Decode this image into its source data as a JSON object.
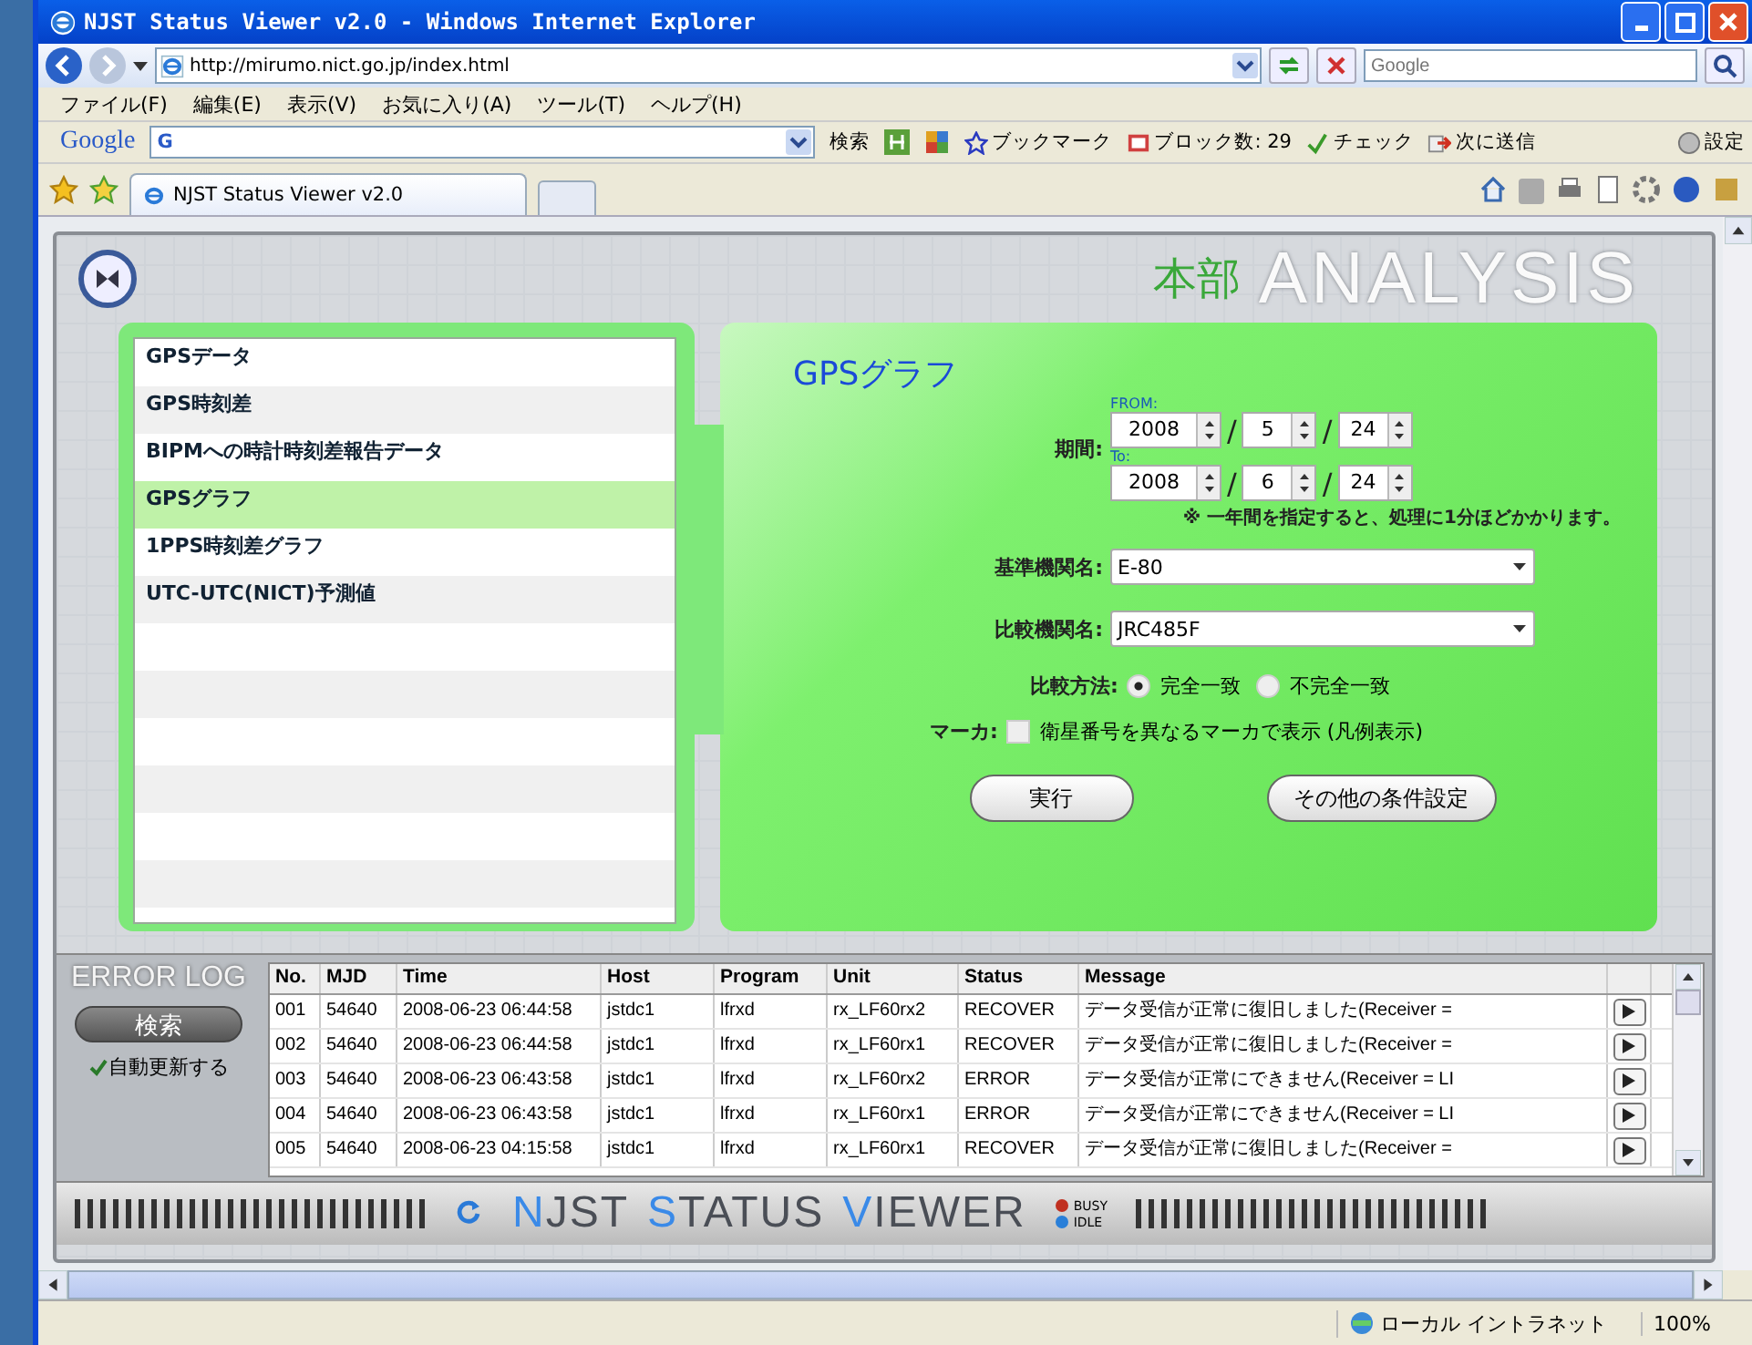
{
  "window": {
    "title": "NJST Status Viewer v2.0 - Windows Internet Explorer"
  },
  "address": {
    "url": "http://mirumo.nict.go.jp/index.html",
    "search_placeholder": "Google"
  },
  "menu": [
    "ファイル(F)",
    "編集(E)",
    "表示(V)",
    "お気に入り(A)",
    "ツール(T)",
    "ヘルプ(H)"
  ],
  "google_toolbar": {
    "logo": "Google",
    "field_logo": "G",
    "search": "検索",
    "bookmarks": "ブックマーク",
    "blocked": "ブロック数: 29",
    "check": "チェック",
    "send": "次に送信",
    "settings": "設定"
  },
  "tab": {
    "label": "NJST Status Viewer v2.0"
  },
  "app": {
    "header_office": "本部",
    "header_mode": "ANALYSIS",
    "menu_items": [
      {
        "label": "GPSデータ",
        "selected": false
      },
      {
        "label": "GPS時刻差",
        "selected": false
      },
      {
        "label": "BIPMへの時計時刻差報告データ",
        "selected": false
      },
      {
        "label": "GPSグラフ",
        "selected": true
      },
      {
        "label": "1PPS時刻差グラフ",
        "selected": false
      },
      {
        "label": "UTC-UTC(NICT)予測値",
        "selected": false
      }
    ],
    "form": {
      "title": "GPSグラフ",
      "period_label": "期間:",
      "from_label": "FROM:",
      "to_label": "To:",
      "from": [
        "2008",
        "5",
        "24"
      ],
      "to": [
        "2008",
        "6",
        "24"
      ],
      "separator": "/",
      "note": "※ 一年間を指定すると、処理に1分ほどかかります。",
      "base_label": "基準機関名:",
      "base_value": "E-80",
      "compare_label": "比較機関名:",
      "compare_value": "JRC485F",
      "method_label": "比較方法:",
      "methods": [
        {
          "label": "完全一致",
          "selected": true
        },
        {
          "label": "不完全一致",
          "selected": false
        }
      ],
      "marker_label": "マーカ:",
      "marker": {
        "label": "衛星番号を異なるマーカで表示 (凡例表示)",
        "checked": false
      },
      "buttons": [
        "実行",
        "その他の条件設定"
      ]
    },
    "error_log": {
      "title": "ERROR LOG",
      "search_button": "検索",
      "auto_refresh": {
        "label": "自動更新する",
        "checked": true
      },
      "columns": [
        "No.",
        "MJD",
        "Time",
        "Host",
        "Program",
        "Unit",
        "Status",
        "Message"
      ],
      "rows": [
        [
          "001",
          "54640",
          "2008-06-23 06:44:58",
          "jstdc1",
          "lfrxd",
          "rx_LF60rx2",
          "RECOVER",
          "データ受信が正常に復旧しました(Receiver ="
        ],
        [
          "002",
          "54640",
          "2008-06-23 06:44:58",
          "jstdc1",
          "lfrxd",
          "rx_LF60rx1",
          "RECOVER",
          "データ受信が正常に復旧しました(Receiver ="
        ],
        [
          "003",
          "54640",
          "2008-06-23 06:43:58",
          "jstdc1",
          "lfrxd",
          "rx_LF60rx2",
          "ERROR",
          "データ受信が正常にできません(Receiver = LI"
        ],
        [
          "004",
          "54640",
          "2008-06-23 06:43:58",
          "jstdc1",
          "lfrxd",
          "rx_LF60rx1",
          "ERROR",
          "データ受信が正常にできません(Receiver = LI"
        ],
        [
          "005",
          "54640",
          "2008-06-23 04:15:58",
          "jstdc1",
          "lfrxd",
          "rx_LF60rx1",
          "RECOVER",
          "データ受信が正常に復旧しました(Receiver ="
        ]
      ]
    },
    "footer": {
      "title_words": [
        "NJST",
        "STATUS",
        "VIEWER"
      ],
      "indicators": [
        {
          "label": "BUSY",
          "color": "#c03020"
        },
        {
          "label": "IDLE",
          "color": "#2a7fd8"
        }
      ]
    }
  },
  "status_bar": {
    "zone": "ローカル イントラネット",
    "zoom": "100%"
  }
}
